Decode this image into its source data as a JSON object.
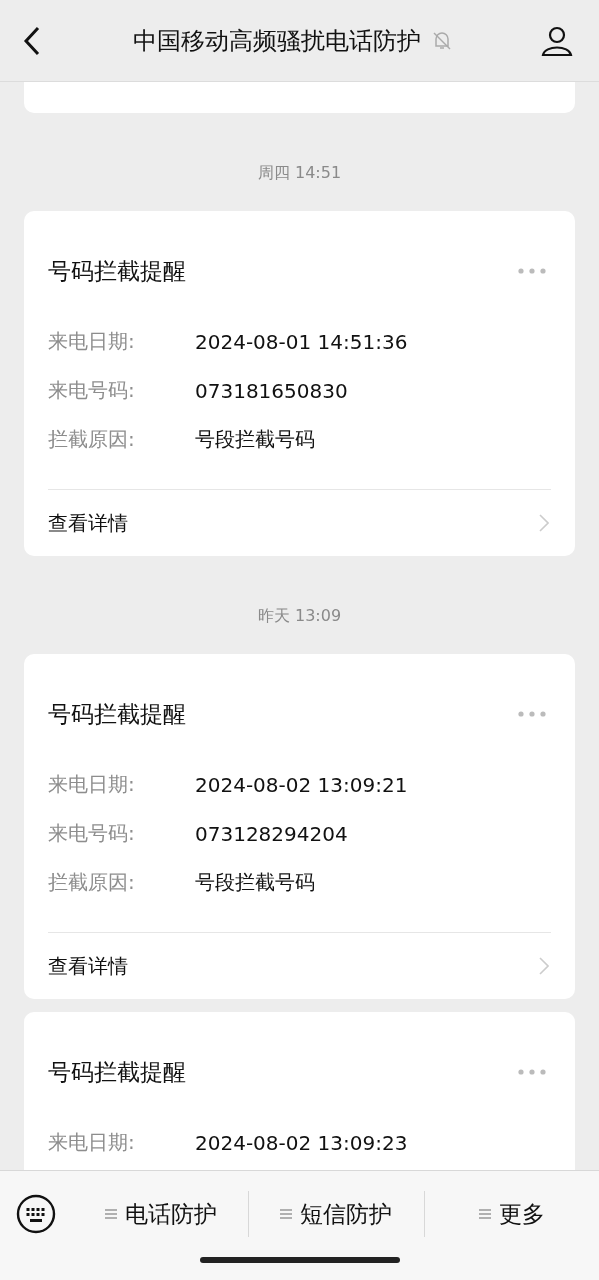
{
  "header": {
    "title": "中国移动高频骚扰电话防护",
    "muted": true
  },
  "messages": [
    {
      "kind": "tail"
    },
    {
      "kind": "card",
      "time": "周四 14:51",
      "title": "号码拦截提醒",
      "fields": [
        {
          "label": "来电日期:",
          "value": "2024-08-01 14:51:36"
        },
        {
          "label": "来电号码:",
          "value": "073181650830"
        },
        {
          "label": "拦截原因:",
          "value": "号段拦截号码"
        }
      ],
      "link": "查看详情"
    },
    {
      "kind": "card",
      "time": "昨天 13:09",
      "title": "号码拦截提醒",
      "fields": [
        {
          "label": "来电日期:",
          "value": "2024-08-02 13:09:21"
        },
        {
          "label": "来电号码:",
          "value": "073128294204"
        },
        {
          "label": "拦截原因:",
          "value": "号段拦截号码"
        }
      ],
      "link": "查看详情"
    },
    {
      "kind": "card",
      "title": "号码拦截提醒",
      "fields": [
        {
          "label": "来电日期:",
          "value": "2024-08-02 13:09:23"
        }
      ]
    }
  ],
  "bottom_menu": [
    "电话防护",
    "短信防护",
    "更多"
  ]
}
